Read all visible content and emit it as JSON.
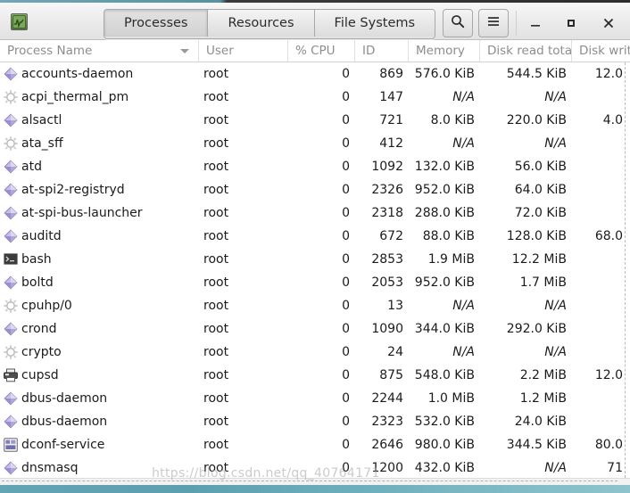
{
  "window": {
    "app_icon": "system-monitor-icon",
    "titlebar_buttons": {
      "search": "search-icon",
      "menu": "hamburger-menu-icon",
      "minimize": "–",
      "maximize": "□",
      "close": "×"
    }
  },
  "tabs": [
    {
      "label": "Processes",
      "active": true
    },
    {
      "label": "Resources",
      "active": false
    },
    {
      "label": "File Systems",
      "active": false
    }
  ],
  "columns": [
    {
      "label": "Process Name",
      "sorted": "descending"
    },
    {
      "label": "User"
    },
    {
      "label": "% CPU"
    },
    {
      "label": "ID"
    },
    {
      "label": "Memory"
    },
    {
      "label": "Disk read tota"
    },
    {
      "label": "Disk writ"
    }
  ],
  "processes": [
    {
      "icon": "diamond-icon",
      "name": "accounts-daemon",
      "user": "root",
      "cpu": "0",
      "id": "869",
      "memory": "576.0 KiB",
      "disk_read": "544.5 KiB",
      "disk_write": "12.0"
    },
    {
      "icon": "gear-icon",
      "name": "acpi_thermal_pm",
      "user": "root",
      "cpu": "0",
      "id": "147",
      "memory": "N/A",
      "disk_read": "N/A",
      "disk_write": ""
    },
    {
      "icon": "diamond-icon",
      "name": "alsactl",
      "user": "root",
      "cpu": "0",
      "id": "721",
      "memory": "8.0 KiB",
      "disk_read": "220.0 KiB",
      "disk_write": "4.0"
    },
    {
      "icon": "gear-icon",
      "name": "ata_sff",
      "user": "root",
      "cpu": "0",
      "id": "412",
      "memory": "N/A",
      "disk_read": "N/A",
      "disk_write": ""
    },
    {
      "icon": "diamond-icon",
      "name": "atd",
      "user": "root",
      "cpu": "0",
      "id": "1092",
      "memory": "132.0 KiB",
      "disk_read": "56.0 KiB",
      "disk_write": ""
    },
    {
      "icon": "diamond-icon",
      "name": "at-spi2-registryd",
      "user": "root",
      "cpu": "0",
      "id": "2326",
      "memory": "952.0 KiB",
      "disk_read": "64.0 KiB",
      "disk_write": ""
    },
    {
      "icon": "diamond-icon",
      "name": "at-spi-bus-launcher",
      "user": "root",
      "cpu": "0",
      "id": "2318",
      "memory": "288.0 KiB",
      "disk_read": "72.0 KiB",
      "disk_write": ""
    },
    {
      "icon": "diamond-icon",
      "name": "auditd",
      "user": "root",
      "cpu": "0",
      "id": "672",
      "memory": "88.0 KiB",
      "disk_read": "128.0 KiB",
      "disk_write": "68.0"
    },
    {
      "icon": "terminal-icon",
      "name": "bash",
      "user": "root",
      "cpu": "0",
      "id": "2853",
      "memory": "1.9 MiB",
      "disk_read": "12.2 MiB",
      "disk_write": ""
    },
    {
      "icon": "diamond-icon",
      "name": "boltd",
      "user": "root",
      "cpu": "0",
      "id": "2053",
      "memory": "952.0 KiB",
      "disk_read": "1.7 MiB",
      "disk_write": ""
    },
    {
      "icon": "gear-icon",
      "name": "cpuhp/0",
      "user": "root",
      "cpu": "0",
      "id": "13",
      "memory": "N/A",
      "disk_read": "N/A",
      "disk_write": ""
    },
    {
      "icon": "diamond-icon",
      "name": "crond",
      "user": "root",
      "cpu": "0",
      "id": "1090",
      "memory": "344.0 KiB",
      "disk_read": "292.0 KiB",
      "disk_write": ""
    },
    {
      "icon": "gear-icon",
      "name": "crypto",
      "user": "root",
      "cpu": "0",
      "id": "24",
      "memory": "N/A",
      "disk_read": "N/A",
      "disk_write": ""
    },
    {
      "icon": "printer-icon",
      "name": "cupsd",
      "user": "root",
      "cpu": "0",
      "id": "875",
      "memory": "548.0 KiB",
      "disk_read": "2.2 MiB",
      "disk_write": "12.0"
    },
    {
      "icon": "diamond-icon",
      "name": "dbus-daemon",
      "user": "root",
      "cpu": "0",
      "id": "2244",
      "memory": "1.0 MiB",
      "disk_read": "1.2 MiB",
      "disk_write": ""
    },
    {
      "icon": "diamond-icon",
      "name": "dbus-daemon",
      "user": "root",
      "cpu": "0",
      "id": "2323",
      "memory": "532.0 KiB",
      "disk_read": "24.0 KiB",
      "disk_write": ""
    },
    {
      "icon": "settings-icon",
      "name": "dconf-service",
      "user": "root",
      "cpu": "0",
      "id": "2646",
      "memory": "980.0 KiB",
      "disk_read": "344.5 KiB",
      "disk_write": "80.0"
    },
    {
      "icon": "diamond-icon",
      "name": "dnsmasq",
      "user": "root",
      "cpu": "0",
      "id": "1200",
      "memory": "432.0 KiB",
      "disk_read": "N/A",
      "disk_write": "71"
    }
  ],
  "watermark": "https://blog.csdn.net/qq_40764171",
  "colors": {
    "accent_green": "#4e7a33",
    "header_bg": "#ebebeb",
    "text": "#1b1b1b",
    "muted": "#8d8d8d",
    "desktop": "#63a4b5"
  }
}
